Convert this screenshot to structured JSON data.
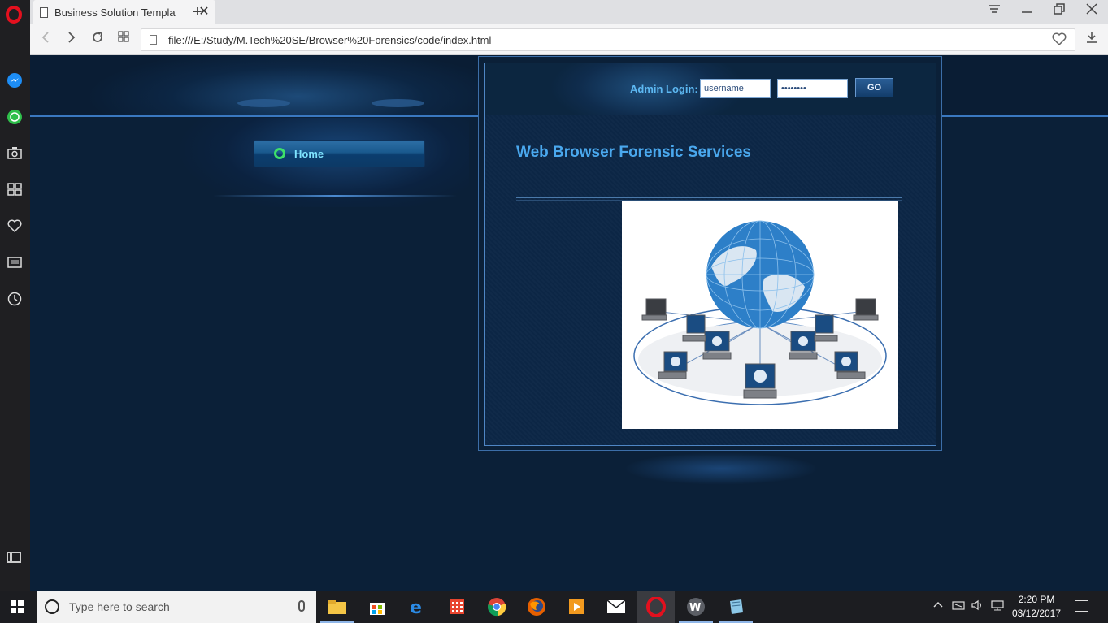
{
  "browser": {
    "tab_title": "Business Solution Template",
    "tab_close": "✕",
    "new_tab": "+",
    "url": "file:///E:/Study/M.Tech%20SE/Browser%20Forensics/code/index.html"
  },
  "page": {
    "menu": {
      "home_label": "Home"
    },
    "login": {
      "label": "Admin Login:",
      "username_value": "username",
      "password_value": "••••••••",
      "go_label": "GO"
    },
    "heading": "Web Browser Forensic Services"
  },
  "taskbar": {
    "search_placeholder": "Type here to search",
    "time": "2:20 PM",
    "date": "03/12/2017"
  },
  "colors": {
    "page_background": "#0b2038",
    "heading": "#4aa8ee",
    "accent_line": "#3a78c0",
    "opera_red": "#e3101e"
  }
}
